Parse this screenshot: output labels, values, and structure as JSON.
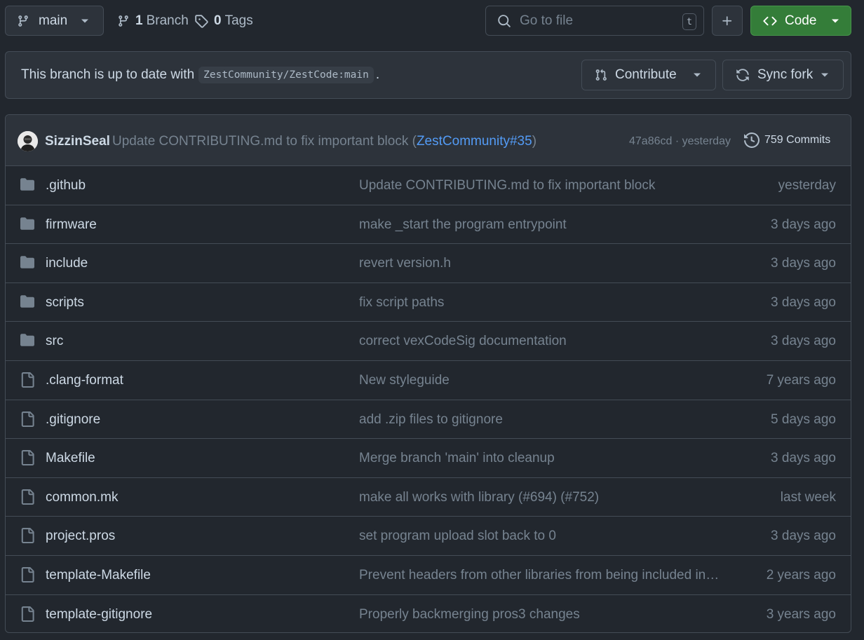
{
  "toolbar": {
    "branch_label": "main",
    "branch_count": "1",
    "branch_word": "Branch",
    "tag_count": "0",
    "tag_word": "Tags",
    "goto_placeholder": "Go to file",
    "goto_shortcut": "t",
    "code_label": "Code"
  },
  "banner": {
    "text_before": "This branch is up to date with",
    "upstream_ref": "ZestCommunity/ZestCode:main",
    "text_after": ".",
    "contribute_label": "Contribute",
    "sync_label": "Sync fork"
  },
  "latest_commit": {
    "author": "SizzinSeal",
    "message": "Update CONTRIBUTING.md to fix important block (",
    "pr_link": "ZestCommunity#35",
    "message_end": ")",
    "sha_time": "47a86cd · yesterday",
    "commits_label": "759 Commits"
  },
  "files": [
    {
      "type": "folder",
      "name": ".github",
      "message": "Update CONTRIBUTING.md to fix important block",
      "date": "yesterday"
    },
    {
      "type": "folder",
      "name": "firmware",
      "message": "make _start the program entrypoint",
      "date": "3 days ago"
    },
    {
      "type": "folder",
      "name": "include",
      "message": "revert version.h",
      "date": "3 days ago"
    },
    {
      "type": "folder",
      "name": "scripts",
      "message": "fix script paths",
      "date": "3 days ago"
    },
    {
      "type": "folder",
      "name": "src",
      "message": "correct vexCodeSig documentation",
      "date": "3 days ago"
    },
    {
      "type": "file",
      "name": ".clang-format",
      "message": "New styleguide",
      "date": "7 years ago"
    },
    {
      "type": "file",
      "name": ".gitignore",
      "message": "add .zip files to gitignore",
      "date": "5 days ago"
    },
    {
      "type": "file",
      "name": "Makefile",
      "message": "Merge branch 'main' into cleanup",
      "date": "3 days ago"
    },
    {
      "type": "file",
      "name": "common.mk",
      "message": "make all works with library (#694) (#752)",
      "date": "last week"
    },
    {
      "type": "file",
      "name": "project.pros",
      "message": "set program upload slot back to 0",
      "date": "3 days ago"
    },
    {
      "type": "file",
      "name": "template-Makefile",
      "message": "Prevent headers from other libraries from being included in…",
      "date": "2 years ago"
    },
    {
      "type": "file",
      "name": "template-gitignore",
      "message": "Properly backmerging pros3 changes",
      "date": "3 years ago"
    }
  ],
  "colors": {
    "background": "#22272e",
    "panel": "#2d333b",
    "border": "#444c56",
    "accent_green": "#347d39",
    "link_blue": "#539bf5"
  },
  "icons": {
    "branch": "git-branch-icon",
    "tag": "tag-icon",
    "search": "search-icon",
    "plus": "plus-icon",
    "code": "code-icon",
    "contribute": "git-pull-request-icon",
    "sync": "sync-icon",
    "history": "history-icon",
    "folder": "folder-icon",
    "file": "file-icon"
  }
}
